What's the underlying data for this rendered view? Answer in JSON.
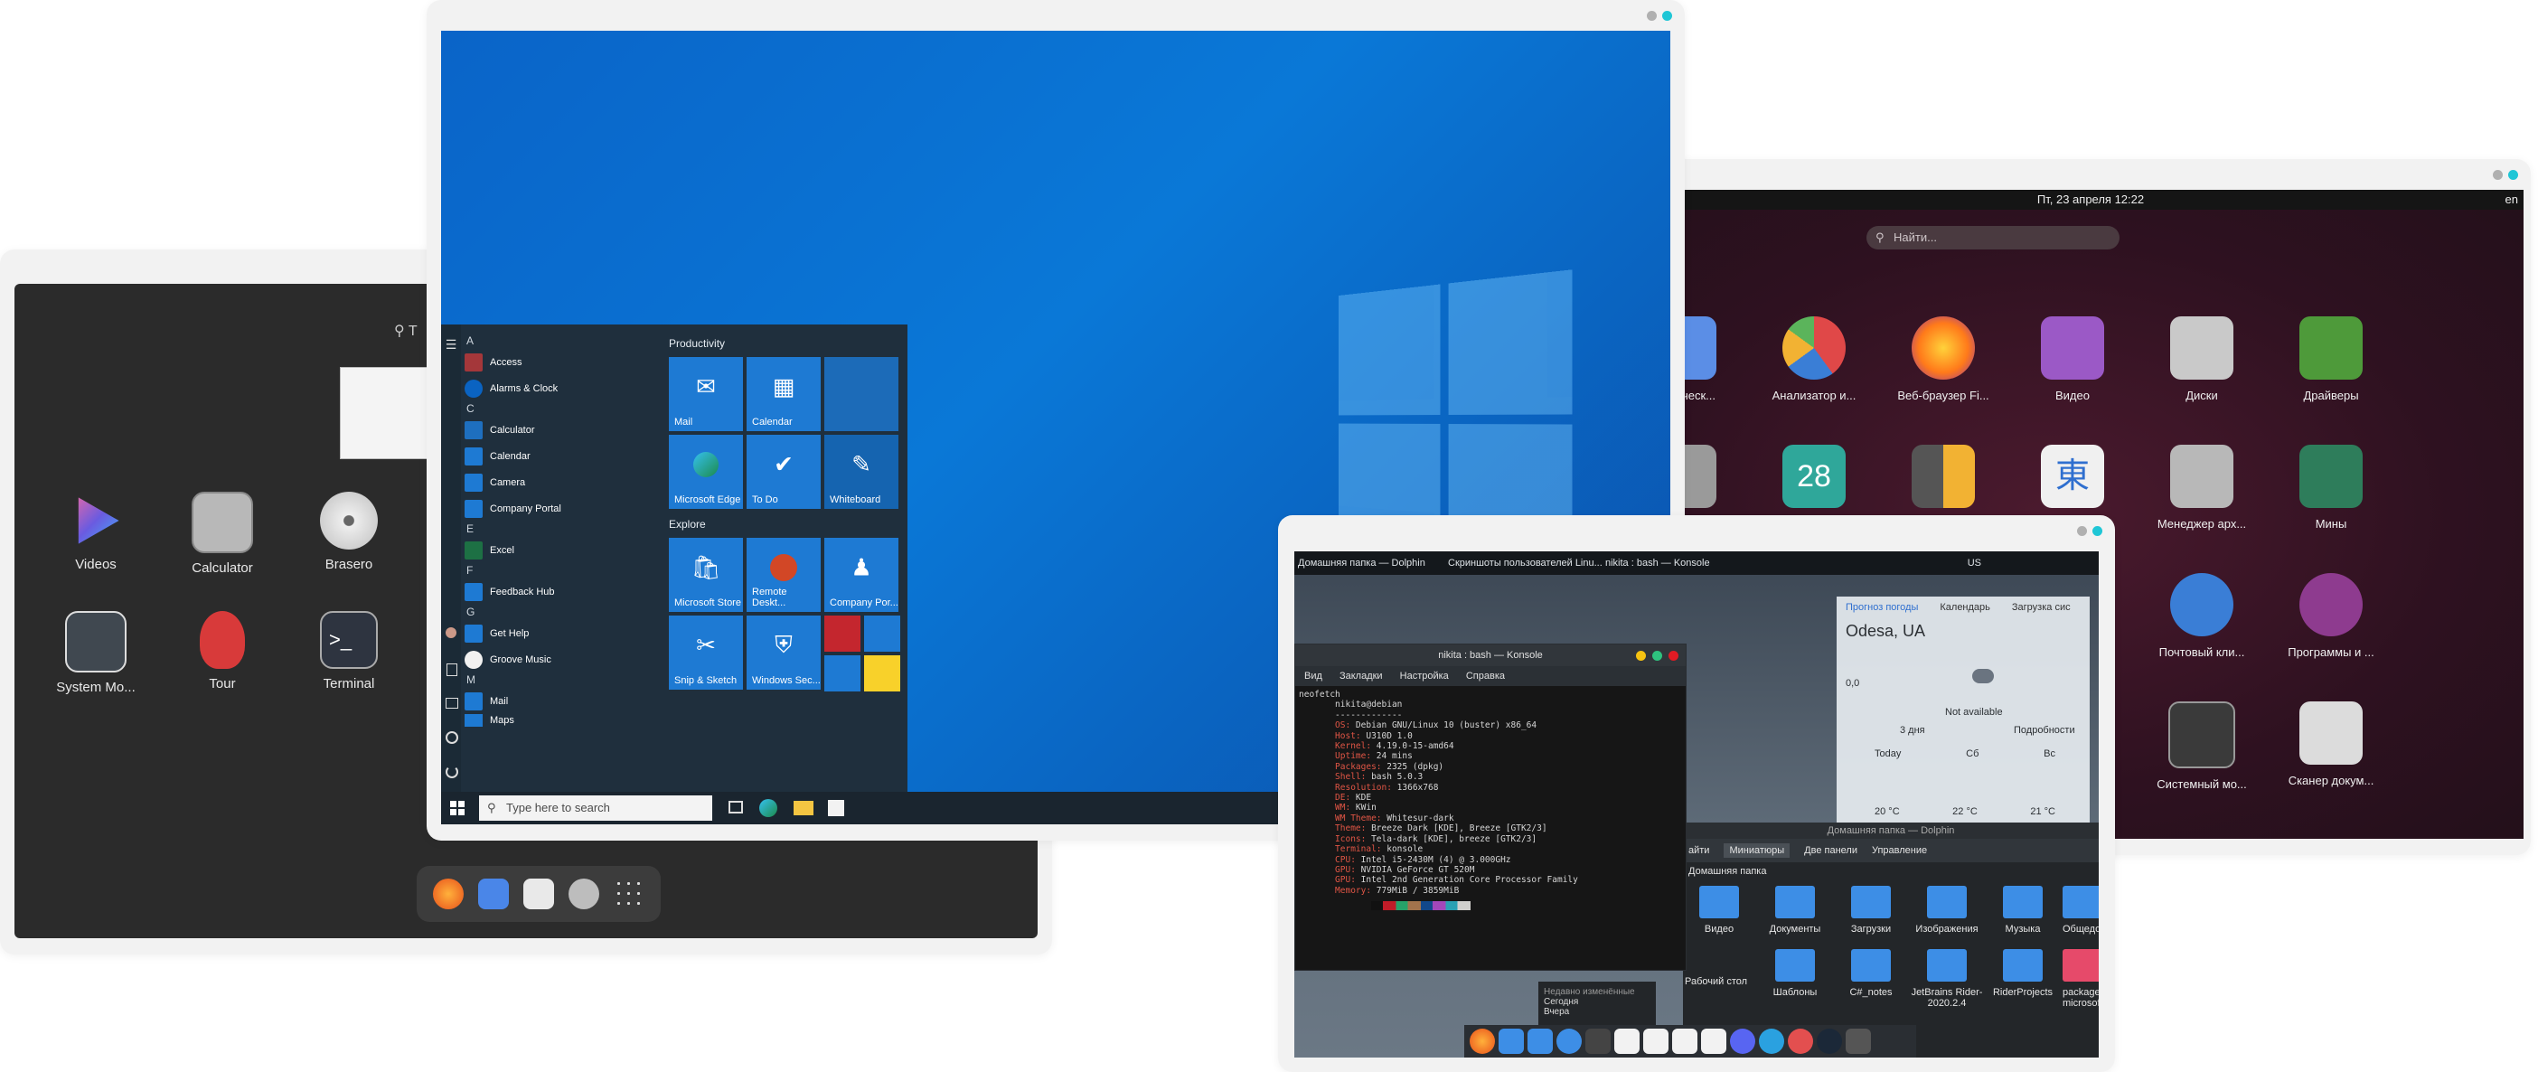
{
  "gnome": {
    "search_hint": "T",
    "apps": [
      {
        "label": "Videos",
        "color": "#6a5be0"
      },
      {
        "label": "Calculator",
        "color": "#b8b8b8"
      },
      {
        "label": "Brasero",
        "color": "#d8d8d8"
      },
      {
        "label": "System Mo...",
        "color": "#404850"
      },
      {
        "label": "Tour",
        "color": "#d83a3a"
      },
      {
        "label": "Terminal",
        "color": "#2e3440"
      }
    ],
    "dock": [
      "firefox-icon",
      "files-icon",
      "software-icon",
      "settings-icon",
      "app-grid-icon"
    ]
  },
  "windows": {
    "menu_letters": {
      "a": "A",
      "c": "C",
      "e": "E",
      "f": "F",
      "g": "G",
      "m": "M"
    },
    "apps": {
      "access": "Access",
      "alarms": "Alarms & Clock",
      "calculator": "Calculator",
      "calendar": "Calendar",
      "camera": "Camera",
      "company_portal": "Company Portal",
      "excel": "Excel",
      "feedback": "Feedback Hub",
      "get_help": "Get Help",
      "groove": "Groove Music",
      "mail": "Mail",
      "maps": "Maps"
    },
    "productivity_title": "Productivity",
    "explore_title": "Explore",
    "tiles": {
      "mail": "Mail",
      "calendar": "Calendar",
      "edge": "Microsoft Edge",
      "todo": "To Do",
      "whiteboard": "Whiteboard",
      "store": "Microsoft Store",
      "remote": "Remote Deskt...",
      "company": "Company Por...",
      "snip": "Snip & Sketch",
      "security": "Windows Sec..."
    },
    "search_placeholder": "Type here to search"
  },
  "ubuntu": {
    "datetime": "Пт, 23 апреля  12:22",
    "lang": "en",
    "search_placeholder": "Найти...",
    "apps": [
      {
        "label": "...атическ...",
        "color": "#5b8ee6"
      },
      {
        "label": "Анализатор и...",
        "color": "#e04848"
      },
      {
        "label": "Веб-браузер Fi...",
        "color": "#ff7a1a"
      },
      {
        "label": "Видео",
        "color": "#9b59c6"
      },
      {
        "label": "Диски",
        "color": "#c9c9c9"
      },
      {
        "label": "Драйверы",
        "color": "#4e9a3a"
      },
      {
        "label": "",
        "color": "#9a9a9a"
      },
      {
        "label": "",
        "color": "#2fa79a"
      },
      {
        "label": "",
        "color": "#555555"
      },
      {
        "label": "",
        "color": "#f0f0f0"
      },
      {
        "label": "Менеджер арх...",
        "color": "#b8b8b8"
      },
      {
        "label": "Мины",
        "color": "#2e7d5b"
      },
      {
        "label": "Почтовый кли...",
        "color": "#3a7ed6"
      },
      {
        "label": "Программы и ...",
        "color": "#8e3b8f"
      },
      {
        "label": "Системный мо...",
        "color": "#3a3a3a"
      },
      {
        "label": "Сканер докум...",
        "color": "#dcdcdc"
      }
    ],
    "calendar_day": "28",
    "kanji": "東"
  },
  "kde": {
    "top_items": {
      "dolphin": "Домашняя папка — Dolphin",
      "screens": "Скриншоты пользователей Linu...",
      "konsole": "nikita : bash — Konsole",
      "layout": "US"
    },
    "konsole_title": "nikita : bash — Konsole",
    "konsole_menu": [
      "Вид",
      "Закладки",
      "Настройка",
      "Справка"
    ],
    "neofetch": [
      "neofetch",
      "       nikita@debian",
      "       -------------",
      "       OS: Debian GNU/Linux 10 (buster) x86_64",
      "       Host: U310D 1.0",
      "       Kernel: 4.19.0-15-amd64",
      "       Uptime: 24 mins",
      "       Packages: 2325 (dpkg)",
      "       Shell: bash 5.0.3",
      "       Resolution: 1366x768",
      "       DE: KDE",
      "       WM: KWin",
      "       WM Theme: Whitesur-dark",
      "       Theme: Breeze Dark [KDE], Breeze [GTK2/3]",
      "       Icons: Tela-dark [KDE], breeze [GTK2/3]",
      "       Terminal: konsole",
      "       CPU: Intel i5-2430M (4) @ 3.000GHz",
      "       GPU: NVIDIA GeForce GT 520M",
      "       GPU: Intel 2nd Generation Core Processor Family",
      "       Memory: 779MiB / 3859MiB"
    ],
    "weather": {
      "tabs": [
        "Прогноз погоды",
        "Календарь",
        "Загрузка сис"
      ],
      "city": "Odesa, UA",
      "zero": "0,0",
      "status": "Not available",
      "period": "3 дня",
      "details": "Подробности",
      "days": [
        "Today",
        "Сб",
        "Вс"
      ],
      "temps": [
        "20 °C",
        "22 °C",
        "21 °C"
      ]
    },
    "dolphin": {
      "title": "Домашняя папка — Dolphin",
      "toolbar": [
        "айти",
        "Миниатюры",
        "Две панели",
        "Управление"
      ],
      "location": "Домашняя папка",
      "folders": [
        "Видео",
        "Документы",
        "Загрузки",
        "Изображения",
        "Музыка",
        "Общедост",
        "",
        "Шаблоны",
        "C#_notes",
        "JetBrains Rider-2020.2.4",
        "RiderProjects",
        "package microsoft.deb"
      ],
      "desktop": "Рабочий стол",
      "recent_title": "Недавно изменённые",
      "recent": [
        "Сегодня",
        "Вчера"
      ]
    }
  }
}
